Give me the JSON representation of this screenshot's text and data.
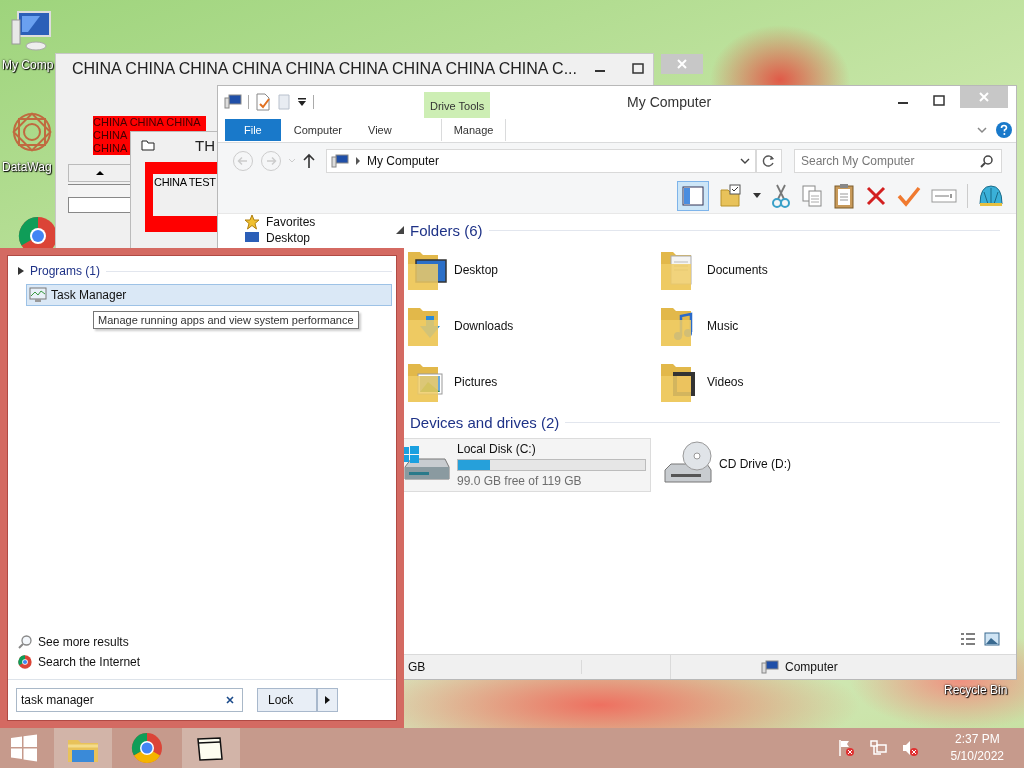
{
  "desktop": {
    "icons": [
      {
        "label": "My Comp",
        "kind": "computer"
      },
      {
        "label": "DataWag",
        "kind": "app"
      }
    ],
    "recycle_bin_label": "Recycle Bin"
  },
  "back_window": {
    "title": "CHINA CHINA CHINA CHINA CHINA CHINA CHINA CHINA CHINA C...",
    "label_lines": [
      "CHINA CHINA CHINA",
      "CHINA",
      "CHINA"
    ]
  },
  "dialog_window": {
    "title": "TH",
    "text": "CHINA TEST"
  },
  "explorer": {
    "title": "My Computer",
    "context_tab": "Drive Tools",
    "ribbon_tabs": [
      {
        "label": "File",
        "kind": "file"
      },
      {
        "label": "Computer",
        "kind": "tab"
      },
      {
        "label": "View",
        "kind": "tab"
      },
      {
        "label": "Manage",
        "kind": "context"
      }
    ],
    "address": "My Computer",
    "search": {
      "placeholder": "Search My Computer"
    },
    "nav": [
      {
        "label": "Favorites",
        "kind": "star"
      },
      {
        "label": "Desktop",
        "kind": "desktop"
      }
    ],
    "folders_header": "Folders (6)",
    "folders": [
      {
        "label": "Desktop",
        "kind": "desktop"
      },
      {
        "label": "Documents",
        "kind": "documents"
      },
      {
        "label": "Downloads",
        "kind": "downloads"
      },
      {
        "label": "Music",
        "kind": "music"
      },
      {
        "label": "Pictures",
        "kind": "pictures"
      },
      {
        "label": "Videos",
        "kind": "videos"
      }
    ],
    "drives_header": "Devices and drives (2)",
    "drives": [
      {
        "label": "Local Disk (C:)",
        "kind": "hdd",
        "level": 0.17,
        "free": "99.0 GB free of 119 GB"
      },
      {
        "label": "CD Drive (D:)",
        "kind": "cd"
      }
    ],
    "status": {
      "left": "GB",
      "right": "Computer"
    }
  },
  "start_menu": {
    "section": "Programs (1)",
    "results": [
      {
        "label": "Task Manager",
        "selected": true
      }
    ],
    "tooltip": "Manage running apps and view system performance",
    "links": [
      {
        "label": "See more results",
        "kind": "search"
      },
      {
        "label": "Search the Internet",
        "kind": "web"
      }
    ],
    "search": {
      "value": "task manager"
    },
    "power_button": "Lock"
  },
  "taskbar": {
    "time": "2:37 PM",
    "date": "5/10/2022"
  }
}
